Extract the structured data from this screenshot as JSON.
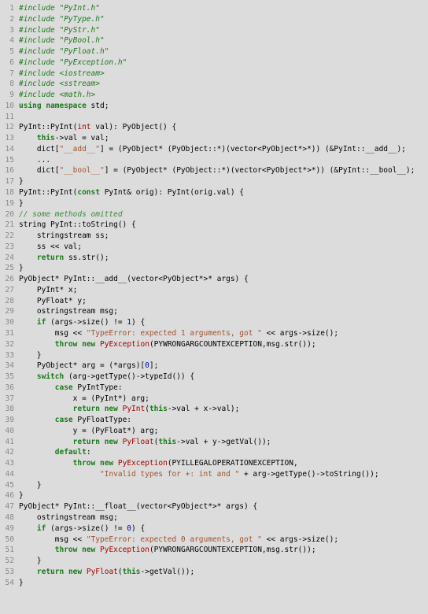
{
  "lines": [
    {
      "n": 1,
      "segs": [
        {
          "t": "#include \"PyInt.h\"",
          "c": "pp"
        }
      ]
    },
    {
      "n": 2,
      "segs": [
        {
          "t": "#include \"PyType.h\"",
          "c": "pp"
        }
      ]
    },
    {
      "n": 3,
      "segs": [
        {
          "t": "#include \"PyStr.h\"",
          "c": "pp"
        }
      ]
    },
    {
      "n": 4,
      "segs": [
        {
          "t": "#include \"PyBool.h\"",
          "c": "pp"
        }
      ]
    },
    {
      "n": 5,
      "segs": [
        {
          "t": "#include \"PyFloat.h\"",
          "c": "pp"
        }
      ]
    },
    {
      "n": 6,
      "segs": [
        {
          "t": "#include \"PyException.h\"",
          "c": "pp"
        }
      ]
    },
    {
      "n": 7,
      "segs": [
        {
          "t": "#include <iostream>",
          "c": "pp"
        }
      ]
    },
    {
      "n": 8,
      "segs": [
        {
          "t": "#include <sstream>",
          "c": "pp"
        }
      ]
    },
    {
      "n": 9,
      "segs": [
        {
          "t": "#include <math.h>",
          "c": "pp"
        }
      ]
    },
    {
      "n": 10,
      "segs": [
        {
          "t": "using",
          "c": "kw"
        },
        {
          "t": " "
        },
        {
          "t": "namespace",
          "c": "kw"
        },
        {
          "t": " std;"
        }
      ]
    },
    {
      "n": 11,
      "segs": [
        {
          "t": ""
        }
      ]
    },
    {
      "n": 12,
      "segs": [
        {
          "t": "PyInt::PyInt("
        },
        {
          "t": "int",
          "c": "ty"
        },
        {
          "t": " val): PyObject() {"
        }
      ]
    },
    {
      "n": 13,
      "segs": [
        {
          "t": "    "
        },
        {
          "t": "this",
          "c": "kw"
        },
        {
          "t": "->val = val;"
        }
      ]
    },
    {
      "n": 14,
      "segs": [
        {
          "t": "    dict["
        },
        {
          "t": "\"__add__\"",
          "c": "str"
        },
        {
          "t": "] = (PyObject* (PyObject::*)(vector<PyObject*>*)) (&PyInt::__add__);"
        }
      ]
    },
    {
      "n": 15,
      "segs": [
        {
          "t": "    ..."
        }
      ]
    },
    {
      "n": 16,
      "segs": [
        {
          "t": "    dict["
        },
        {
          "t": "\"__bool__\"",
          "c": "str"
        },
        {
          "t": "] = (PyObject* (PyObject::*)(vector<PyObject*>*)) (&PyInt::__bool__);"
        }
      ]
    },
    {
      "n": 17,
      "segs": [
        {
          "t": "}"
        }
      ]
    },
    {
      "n": 18,
      "segs": [
        {
          "t": "PyInt::PyInt("
        },
        {
          "t": "const",
          "c": "kw"
        },
        {
          "t": " PyInt& orig): PyInt(orig.val) {"
        }
      ]
    },
    {
      "n": 19,
      "segs": [
        {
          "t": "}"
        }
      ]
    },
    {
      "n": 20,
      "segs": [
        {
          "t": "// some methods omitted",
          "c": "cm"
        }
      ]
    },
    {
      "n": 21,
      "segs": [
        {
          "t": "string PyInt::toString() {"
        }
      ]
    },
    {
      "n": 22,
      "segs": [
        {
          "t": "    stringstream ss;"
        }
      ]
    },
    {
      "n": 23,
      "segs": [
        {
          "t": "    ss << val;"
        }
      ]
    },
    {
      "n": 24,
      "segs": [
        {
          "t": "    "
        },
        {
          "t": "return",
          "c": "kw"
        },
        {
          "t": " ss.str();"
        }
      ]
    },
    {
      "n": 25,
      "segs": [
        {
          "t": "}"
        }
      ]
    },
    {
      "n": 26,
      "segs": [
        {
          "t": "PyObject* PyInt::__add__(vector<PyObject*>* args) {"
        }
      ]
    },
    {
      "n": 27,
      "segs": [
        {
          "t": "    PyInt* x;"
        }
      ]
    },
    {
      "n": 28,
      "segs": [
        {
          "t": "    PyFloat* y;"
        }
      ]
    },
    {
      "n": 29,
      "segs": [
        {
          "t": "    ostringstream msg;"
        }
      ]
    },
    {
      "n": 30,
      "segs": [
        {
          "t": "    "
        },
        {
          "t": "if",
          "c": "kw"
        },
        {
          "t": " (args->size() != "
        },
        {
          "t": "1",
          "c": "num"
        },
        {
          "t": ") {"
        }
      ]
    },
    {
      "n": 31,
      "segs": [
        {
          "t": "        msg << "
        },
        {
          "t": "\"TypeError: expected 1 arguments, got \"",
          "c": "str"
        },
        {
          "t": " << args->size();"
        }
      ]
    },
    {
      "n": 32,
      "segs": [
        {
          "t": "        "
        },
        {
          "t": "throw",
          "c": "kw"
        },
        {
          "t": " "
        },
        {
          "t": "new",
          "c": "kw"
        },
        {
          "t": " "
        },
        {
          "t": "PyException",
          "c": "ty"
        },
        {
          "t": "(PYWRONGARGCOUNTEXCEPTION,msg.str());"
        }
      ]
    },
    {
      "n": 33,
      "segs": [
        {
          "t": "    }"
        }
      ]
    },
    {
      "n": 34,
      "segs": [
        {
          "t": "    PyObject* arg = (*args)["
        },
        {
          "t": "0",
          "c": "num"
        },
        {
          "t": "];"
        }
      ]
    },
    {
      "n": 35,
      "segs": [
        {
          "t": "    "
        },
        {
          "t": "switch",
          "c": "kw"
        },
        {
          "t": " (arg->getType()->typeId()) {"
        }
      ]
    },
    {
      "n": 36,
      "segs": [
        {
          "t": "        "
        },
        {
          "t": "case",
          "c": "kw"
        },
        {
          "t": " PyIntType:"
        }
      ]
    },
    {
      "n": 37,
      "segs": [
        {
          "t": "            x = (PyInt*) arg;"
        }
      ]
    },
    {
      "n": 38,
      "segs": [
        {
          "t": "            "
        },
        {
          "t": "return",
          "c": "kw"
        },
        {
          "t": " "
        },
        {
          "t": "new",
          "c": "kw"
        },
        {
          "t": " "
        },
        {
          "t": "PyInt",
          "c": "ty"
        },
        {
          "t": "("
        },
        {
          "t": "this",
          "c": "kw"
        },
        {
          "t": "->val + x->val);"
        }
      ]
    },
    {
      "n": 39,
      "segs": [
        {
          "t": "        "
        },
        {
          "t": "case",
          "c": "kw"
        },
        {
          "t": " PyFloatType:"
        }
      ]
    },
    {
      "n": 40,
      "segs": [
        {
          "t": "            y = (PyFloat*) arg;"
        }
      ]
    },
    {
      "n": 41,
      "segs": [
        {
          "t": "            "
        },
        {
          "t": "return",
          "c": "kw"
        },
        {
          "t": " "
        },
        {
          "t": "new",
          "c": "kw"
        },
        {
          "t": " "
        },
        {
          "t": "PyFloat",
          "c": "ty"
        },
        {
          "t": "("
        },
        {
          "t": "this",
          "c": "kw"
        },
        {
          "t": "->val + y->getVal());"
        }
      ]
    },
    {
      "n": 42,
      "segs": [
        {
          "t": "        "
        },
        {
          "t": "default",
          "c": "kw"
        },
        {
          "t": ":"
        }
      ]
    },
    {
      "n": 43,
      "segs": [
        {
          "t": "            "
        },
        {
          "t": "throw",
          "c": "kw"
        },
        {
          "t": " "
        },
        {
          "t": "new",
          "c": "kw"
        },
        {
          "t": " "
        },
        {
          "t": "PyException",
          "c": "ty"
        },
        {
          "t": "(PYILLEGALOPERATIONEXCEPTION,"
        }
      ]
    },
    {
      "n": 44,
      "segs": [
        {
          "t": "                  "
        },
        {
          "t": "\"Invalid types for +: int and \"",
          "c": "str"
        },
        {
          "t": " + arg->getType()->toString());"
        }
      ]
    },
    {
      "n": 45,
      "segs": [
        {
          "t": "    }"
        }
      ]
    },
    {
      "n": 46,
      "segs": [
        {
          "t": "}"
        }
      ]
    },
    {
      "n": 47,
      "segs": [
        {
          "t": "PyObject* PyInt::__float__(vector<PyObject*>* args) {"
        }
      ]
    },
    {
      "n": 48,
      "segs": [
        {
          "t": "    ostringstream msg;"
        }
      ]
    },
    {
      "n": 49,
      "segs": [
        {
          "t": "    "
        },
        {
          "t": "if",
          "c": "kw"
        },
        {
          "t": " (args->size() != "
        },
        {
          "t": "0",
          "c": "num"
        },
        {
          "t": ") {"
        }
      ]
    },
    {
      "n": 50,
      "segs": [
        {
          "t": "        msg << "
        },
        {
          "t": "\"TypeError: expected 0 arguments, got \"",
          "c": "str"
        },
        {
          "t": " << args->size();"
        }
      ]
    },
    {
      "n": 51,
      "segs": [
        {
          "t": "        "
        },
        {
          "t": "throw",
          "c": "kw"
        },
        {
          "t": " "
        },
        {
          "t": "new",
          "c": "kw"
        },
        {
          "t": " "
        },
        {
          "t": "PyException",
          "c": "ty"
        },
        {
          "t": "(PYWRONGARGCOUNTEXCEPTION,msg.str());"
        }
      ]
    },
    {
      "n": 52,
      "segs": [
        {
          "t": "    }"
        }
      ]
    },
    {
      "n": 53,
      "segs": [
        {
          "t": "    "
        },
        {
          "t": "return",
          "c": "kw"
        },
        {
          "t": " "
        },
        {
          "t": "new",
          "c": "kw"
        },
        {
          "t": " "
        },
        {
          "t": "PyFloat",
          "c": "ty"
        },
        {
          "t": "("
        },
        {
          "t": "this",
          "c": "kw"
        },
        {
          "t": "->getVal());"
        }
      ]
    },
    {
      "n": 54,
      "segs": [
        {
          "t": "}"
        }
      ]
    }
  ]
}
